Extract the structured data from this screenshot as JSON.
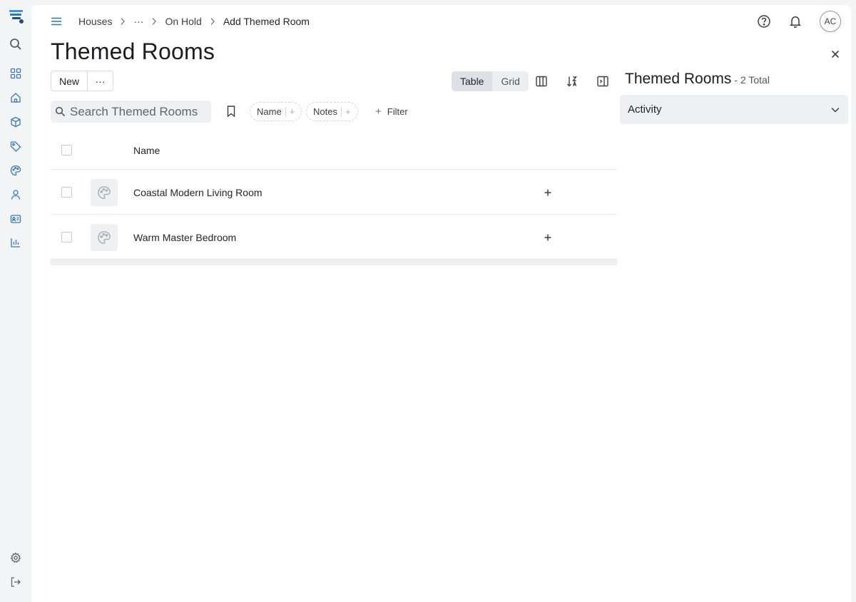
{
  "breadcrumb": {
    "items": [
      "Houses",
      "On Hold",
      "Add Themed Room"
    ],
    "ellipsis": "···"
  },
  "user": {
    "initials": "AC"
  },
  "page": {
    "title": "Themed Rooms"
  },
  "toolbar": {
    "new_label": "New",
    "more_label": "···",
    "views": [
      "Table",
      "Grid"
    ],
    "active_view": "Table"
  },
  "search": {
    "placeholder": "Search Themed Rooms"
  },
  "chips": {
    "name_label": "Name",
    "notes_label": "Notes",
    "plus": "+"
  },
  "filter": {
    "icon": "+",
    "label": "Filter"
  },
  "table": {
    "header": {
      "name": "Name"
    },
    "rows": [
      {
        "name": "Coastal Modern Living Room"
      },
      {
        "name": "Warm Master Bedroom"
      }
    ]
  },
  "side_panel": {
    "title": "Themed Rooms",
    "count_text": "- 2 Total",
    "section_label": "Activity"
  },
  "colors": {
    "logo_blue": "#2b7bb9",
    "logo_dark": "#1d4f7a",
    "icon_blue": "#3b79b6",
    "icon_gray": "#5d6570"
  }
}
